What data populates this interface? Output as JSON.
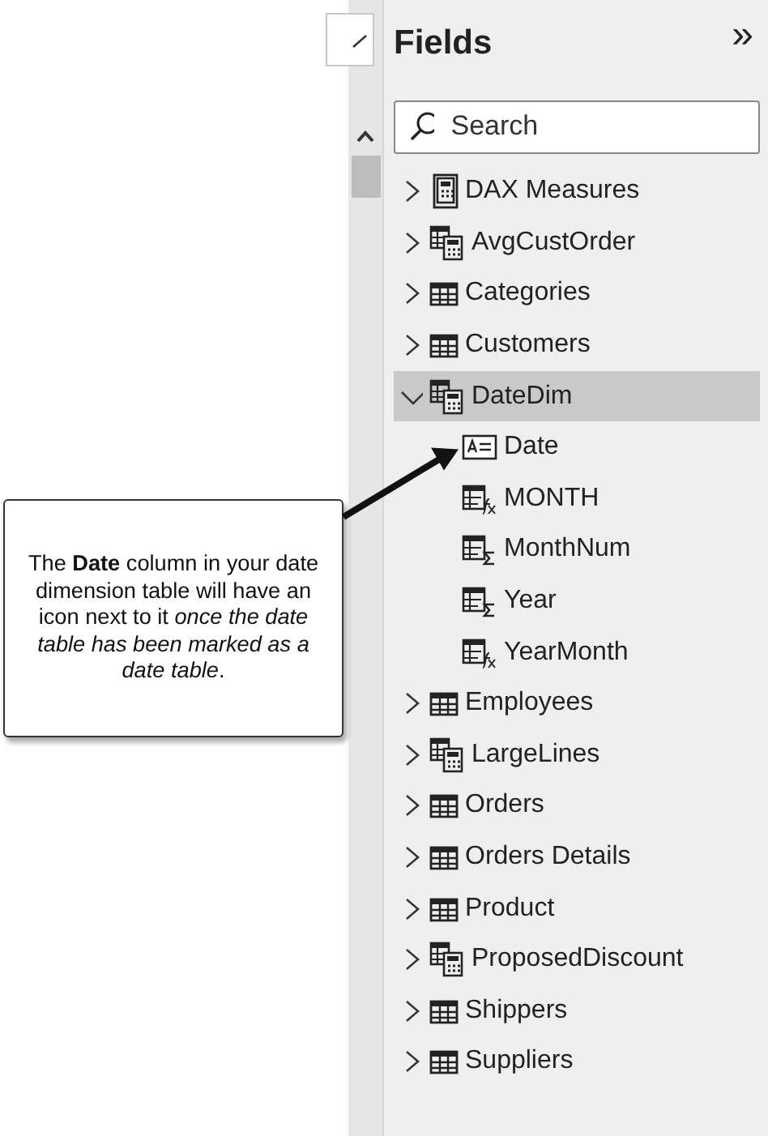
{
  "callout": {
    "text": "The **Date** column in your date dimension table will have an icon next to it *once the date table has been marked as a date table*."
  },
  "fields_pane": {
    "title": "Fields",
    "collapse_glyph": "»",
    "search": {
      "placeholder": "Search"
    },
    "tables": [
      {
        "name": "DAX Measures",
        "kind": "measures",
        "expanded": false,
        "selected": false
      },
      {
        "name": "AvgCustOrder",
        "kind": "calculated",
        "expanded": false,
        "selected": false
      },
      {
        "name": "Categories",
        "kind": "table",
        "expanded": false,
        "selected": false
      },
      {
        "name": "Customers",
        "kind": "table",
        "expanded": false,
        "selected": false
      },
      {
        "name": "DateDim",
        "kind": "calculated",
        "expanded": true,
        "selected": true,
        "children": [
          {
            "name": "Date",
            "kind": "date"
          },
          {
            "name": "MONTH",
            "kind": "calc"
          },
          {
            "name": "MonthNum",
            "kind": "sum"
          },
          {
            "name": "Year",
            "kind": "sum"
          },
          {
            "name": "YearMonth",
            "kind": "calc"
          }
        ]
      },
      {
        "name": "Employees",
        "kind": "table",
        "expanded": false,
        "selected": false
      },
      {
        "name": "LargeLines",
        "kind": "calculated",
        "expanded": false,
        "selected": false
      },
      {
        "name": "Orders",
        "kind": "table",
        "expanded": false,
        "selected": false
      },
      {
        "name": "Orders Details",
        "kind": "table",
        "expanded": false,
        "selected": false
      },
      {
        "name": "Product",
        "kind": "table",
        "expanded": false,
        "selected": false
      },
      {
        "name": "ProposedDiscount",
        "kind": "calculated",
        "expanded": false,
        "selected": false
      },
      {
        "name": "Shippers",
        "kind": "table",
        "expanded": false,
        "selected": false
      },
      {
        "name": "Suppliers",
        "kind": "table",
        "expanded": false,
        "selected": false
      }
    ]
  }
}
